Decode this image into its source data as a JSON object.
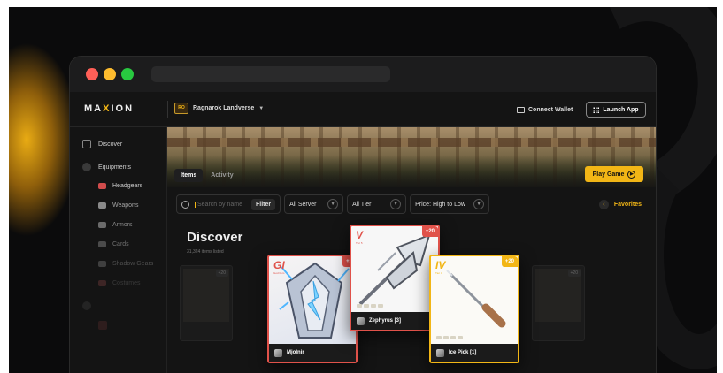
{
  "brand": {
    "logo_pre": "MA",
    "logo_x": "X",
    "logo_post": "ION"
  },
  "topnav": {
    "game": "Ragnarok Landverse",
    "connect_wallet": "Connect Wallet",
    "launch_app": "Launch App"
  },
  "sidebar": {
    "discover": "Discover",
    "equipments": "Equipments",
    "sub_items": [
      "Headgears",
      "Weapons",
      "Armors",
      "Cards",
      "Shadow Gears",
      "Costumes"
    ]
  },
  "banner": {
    "tabs": [
      "Items",
      "Activity"
    ],
    "play_game": "Play Game"
  },
  "filters": {
    "search_placeholder": "Search by name",
    "filter_button": "Filter",
    "server": "All Server",
    "tier": "All Tier",
    "sort": "Price: High to Low",
    "favorites": "Favorites"
  },
  "discover": {
    "title": "Discover",
    "subtitle": "31,324 items listed"
  },
  "cards": [
    {
      "rank": "GI",
      "tier": "God Item",
      "refine": "+2",
      "name": "Mjolnir",
      "accent": "#e0524a"
    },
    {
      "rank": "V",
      "tier": "Tier 5",
      "refine": "+20",
      "name": "Zephyrus [3]",
      "accent": "#e0524a"
    },
    {
      "rank": "IV",
      "tier": "Tier 4",
      "refine": "+20",
      "name": "Ice Pick [1]",
      "accent": "#f2b616"
    }
  ],
  "ghost_cards": [
    {
      "badge": "+20"
    },
    {
      "badge": "+20"
    }
  ],
  "colors": {
    "accent": "#f2b616",
    "rank_red": "#e0524a"
  }
}
